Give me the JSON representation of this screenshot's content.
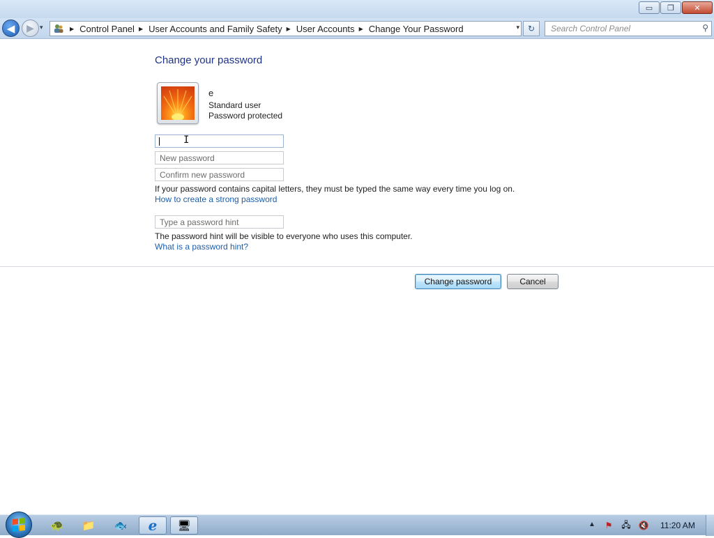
{
  "window": {
    "controls": {
      "minimize": "▭",
      "maximize": "❐",
      "close": "✕"
    }
  },
  "nav": {
    "back_icon": "◀",
    "forward_icon": "▶",
    "recent_icon": "▾",
    "breadcrumbs": [
      "Control Panel",
      "User Accounts and Family Safety",
      "User Accounts",
      "Change Your Password"
    ],
    "dropdown_icon": "▾",
    "refresh_icon": "↻",
    "search_placeholder": "Search Control Panel",
    "search_icon": "⚲"
  },
  "main": {
    "title": "Change your password",
    "user": {
      "name": "e",
      "type": "Standard user",
      "status": "Password protected"
    },
    "fields": {
      "current_value": "",
      "new_placeholder": "New password",
      "confirm_placeholder": "Confirm new password",
      "hint_placeholder": "Type a password hint"
    },
    "capital_letters_note": "If your password contains capital letters, they must be typed the same way every time you log on.",
    "strong_password_link": "How to create a strong password",
    "hint_note": "The password hint will be visible to everyone who uses this computer.",
    "hint_link": "What is a password hint?",
    "buttons": {
      "change": "Change password",
      "cancel": "Cancel"
    }
  },
  "taskbar": {
    "items": [
      {
        "name": "gadget-app",
        "icon": "🐢"
      },
      {
        "name": "file-explorer",
        "icon": "📁"
      },
      {
        "name": "media-app",
        "icon": "🐟"
      },
      {
        "name": "internet-explorer",
        "icon": "ℯ"
      },
      {
        "name": "control-panel",
        "icon": "🖥"
      }
    ],
    "tray": {
      "show_hidden_icon": "▲",
      "icons": [
        "⚑",
        "🖧",
        "🔇"
      ],
      "time": "11:20 AM"
    }
  },
  "colors": {
    "title_blue": "#1e3287",
    "link_blue": "#1e5ea8"
  }
}
